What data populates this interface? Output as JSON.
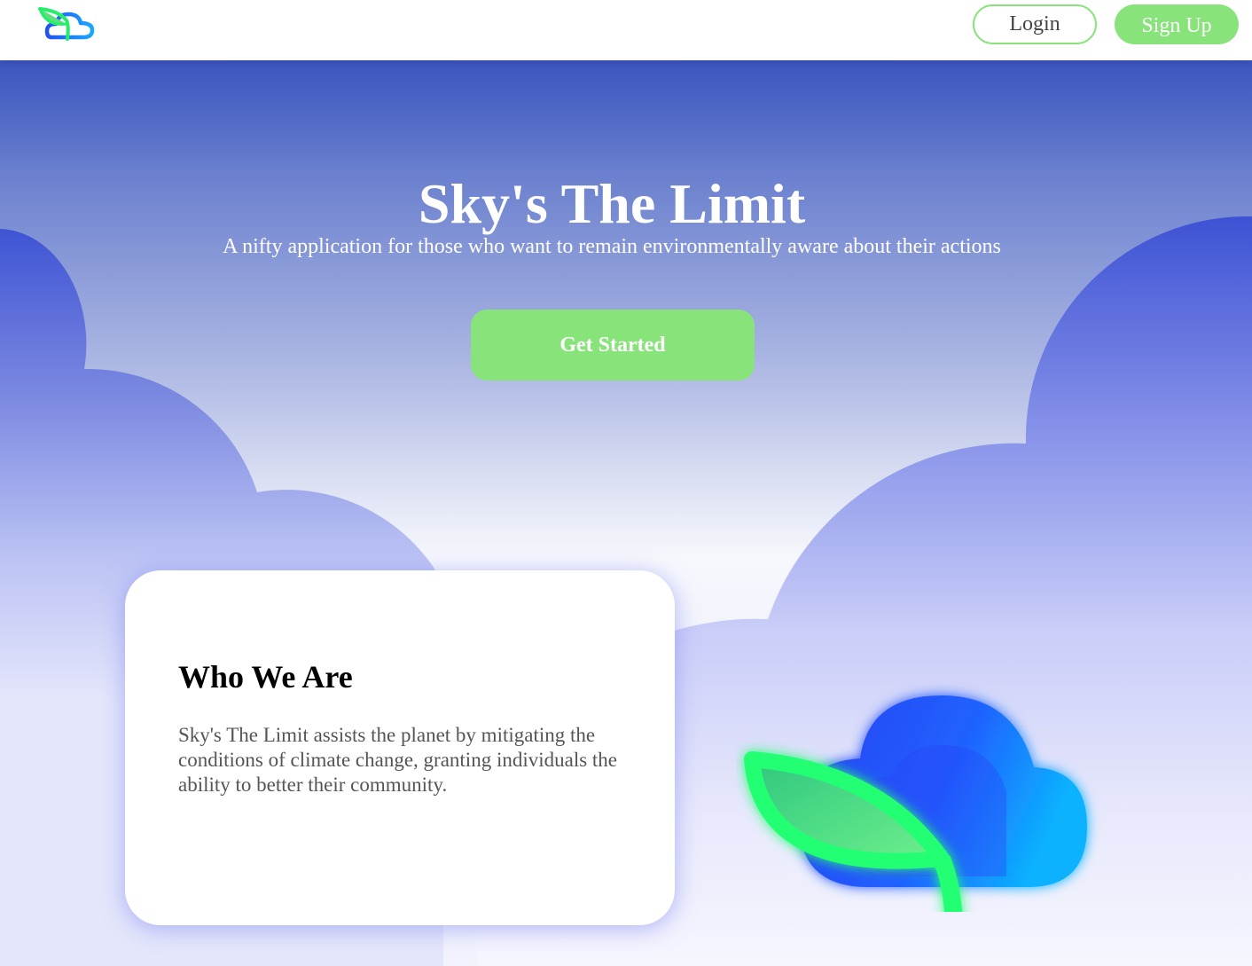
{
  "nav": {
    "logo_icon": "leaf-cloud-logo-icon",
    "login_label": "Login",
    "signup_label": "Sign Up"
  },
  "hero": {
    "title": "Sky's The Limit",
    "subtitle": "A nifty application for those who want to remain environmentally aware about their actions",
    "cta_label": "Get Started"
  },
  "about": {
    "title": "Who We Are",
    "text": "Sky's The Limit assists the planet by mitigating the conditions of climate change, granting individuals the ability to better their community."
  },
  "illustration": {
    "icon": "leaf-cloud-illustration-icon"
  },
  "colors": {
    "accent_green": "#88e47a",
    "sky_top": "#3b55bf",
    "cloud_blue": "#4356d6",
    "illustration_blue": "#1f5cff",
    "illustration_green": "#22ff73"
  }
}
